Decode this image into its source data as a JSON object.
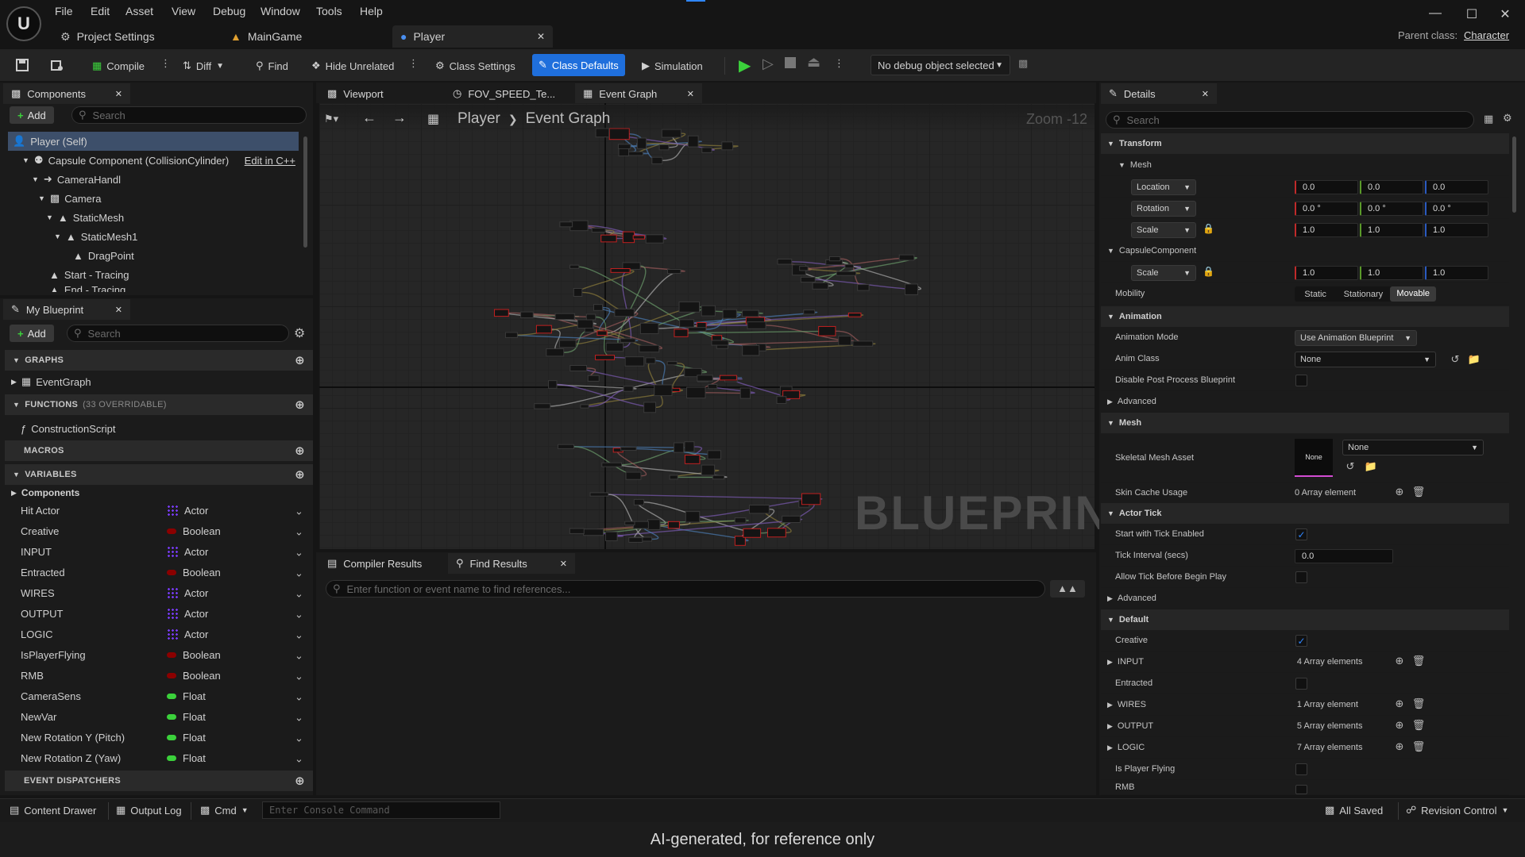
{
  "menu": [
    "File",
    "Edit",
    "Asset",
    "View",
    "Debug",
    "Window",
    "Tools",
    "Help"
  ],
  "doc_tabs": [
    {
      "label": "Project Settings"
    },
    {
      "label": "MainGame"
    },
    {
      "label": "Player"
    }
  ],
  "parent_class": {
    "label": "Parent class:",
    "value": "Character"
  },
  "toolbar": {
    "compile": "Compile",
    "diff": "Diff",
    "find": "Find",
    "hide_unrelated": "Hide Unrelated",
    "class_settings": "Class Settings",
    "class_defaults": "Class Defaults",
    "simulation": "Simulation",
    "debug_object": "No debug object selected"
  },
  "components": {
    "tab": "Components",
    "add": "Add",
    "search_placeholder": "Search",
    "edit_cpp": "Edit in C++",
    "items": [
      {
        "label": "Player (Self)"
      },
      {
        "label": "Capsule Component (CollisionCylinder)"
      },
      {
        "label": "CameraHandl"
      },
      {
        "label": "Camera"
      },
      {
        "label": "StaticMesh"
      },
      {
        "label": "StaticMesh1"
      },
      {
        "label": "DragPoint"
      },
      {
        "label": "Start - Tracing"
      },
      {
        "label": "End - Tracing"
      }
    ]
  },
  "my_blueprint": {
    "tab": "My Blueprint",
    "add": "Add",
    "search_placeholder": "Search",
    "graphs_header": "GRAPHS",
    "event_graph": "EventGraph",
    "functions_header": "FUNCTIONS",
    "functions_count": "(33 OVERRIDABLE)",
    "construction_script": "ConstructionScript",
    "macros_header": "MACROS",
    "variables_header": "VARIABLES",
    "components_cat": "Components",
    "variables": [
      {
        "name": "Hit Actor",
        "type": "Actor",
        "color": "#2aa8e0"
      },
      {
        "name": "Creative",
        "type": "Boolean",
        "color": "#8b0000"
      },
      {
        "name": "INPUT",
        "type": "Actor",
        "color": "#7a3cff"
      },
      {
        "name": "Entracted",
        "type": "Boolean",
        "color": "#8b0000"
      },
      {
        "name": "WIRES",
        "type": "Actor",
        "color": "#7a3cff"
      },
      {
        "name": "OUTPUT",
        "type": "Actor",
        "color": "#7a3cff"
      },
      {
        "name": "LOGIC",
        "type": "Actor",
        "color": "#7a3cff"
      },
      {
        "name": "IsPlayerFlying",
        "type": "Boolean",
        "color": "#8b0000"
      },
      {
        "name": "RMB",
        "type": "Boolean",
        "color": "#8b0000"
      },
      {
        "name": "CameraSens",
        "type": "Float",
        "color": "#3bd13b"
      },
      {
        "name": "NewVar",
        "type": "Float",
        "color": "#3bd13b"
      },
      {
        "name": "New Rotation Y (Pitch)",
        "type": "Float",
        "color": "#3bd13b"
      },
      {
        "name": "New Rotation Z (Yaw)",
        "type": "Float",
        "color": "#3bd13b"
      }
    ],
    "dispatchers_header": "EVENT DISPATCHERS"
  },
  "editor_tabs": [
    {
      "label": "Viewport"
    },
    {
      "label": "FOV_SPEED_Te..."
    },
    {
      "label": "Event Graph"
    }
  ],
  "graph": {
    "breadcrumb_root": "Player",
    "breadcrumb_leaf": "Event Graph",
    "zoom": "Zoom -12",
    "watermark": "BLUEPRINT"
  },
  "bottom_tabs": {
    "compiler": "Compiler Results",
    "find": "Find Results",
    "find_placeholder": "Enter function or event name to find references..."
  },
  "details": {
    "tab": "Details",
    "search_placeholder": "Search",
    "transform": "Transform",
    "mesh": "Mesh",
    "location": "Location",
    "rotation": "Rotation",
    "scale": "Scale",
    "loc": [
      "0.0",
      "0.0",
      "0.0"
    ],
    "rot": [
      "0.0 °",
      "0.0 °",
      "0.0 °"
    ],
    "scl": [
      "1.0",
      "1.0",
      "1.0"
    ],
    "capsule": "CapsuleComponent",
    "cap_scale": [
      "1.0",
      "1.0",
      "1.0"
    ],
    "mobility": "Mobility",
    "mobility_opts": [
      "Static",
      "Stationary",
      "Movable"
    ],
    "animation": "Animation",
    "anim_mode": "Animation Mode",
    "anim_mode_val": "Use Animation Blueprint",
    "anim_class": "Anim Class",
    "anim_class_val": "None",
    "disable_ppb": "Disable Post Process Blueprint",
    "advanced": "Advanced",
    "mesh2": "Mesh",
    "skeletal": "Skeletal Mesh Asset",
    "skeletal_val": "None",
    "thumb": "None",
    "skin_cache": "Skin Cache Usage",
    "skin_cache_val": "0 Array element",
    "actor_tick": "Actor Tick",
    "start_tick": "Start with Tick Enabled",
    "tick_interval": "Tick Interval (secs)",
    "tick_interval_val": "0.0",
    "allow_tick": "Allow Tick Before Begin Play",
    "advanced2": "Advanced",
    "default": "Default",
    "creative": "Creative",
    "input": "INPUT",
    "input_val": "4 Array elements",
    "entracted": "Entracted",
    "wires": "WIRES",
    "wires_val": "1 Array element",
    "output": "OUTPUT",
    "output_val": "5 Array elements",
    "logic": "LOGIC",
    "logic_val": "7 Array elements",
    "is_flying": "Is Player Flying",
    "rmb": "RMB"
  },
  "statusbar": {
    "content_drawer": "Content Drawer",
    "output_log": "Output Log",
    "cmd": "Cmd",
    "console_placeholder": "Enter Console Command",
    "all_saved": "All Saved",
    "revision": "Revision Control"
  },
  "footer": "AI-generated, for reference only"
}
